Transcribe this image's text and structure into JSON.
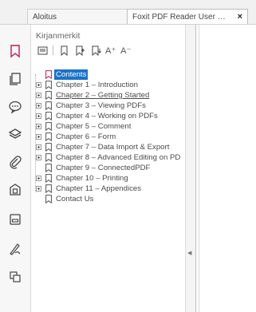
{
  "tabs": [
    {
      "label": "Aloitus"
    },
    {
      "label": "Foxit PDF Reader User M...",
      "close": "×"
    }
  ],
  "rail": {
    "items": [
      {
        "name": "bookmark-icon",
        "active": true
      },
      {
        "name": "pages-icon"
      },
      {
        "name": "comments-icon"
      },
      {
        "name": "layers-icon"
      },
      {
        "name": "attachment-icon"
      },
      {
        "name": "security-icon"
      },
      {
        "name": "form-fields-icon"
      },
      {
        "name": "signature-icon"
      },
      {
        "name": "page-thumbnails-icon"
      }
    ]
  },
  "panel": {
    "title": "Kirjanmerkit",
    "toolbar": {
      "font_larger": "A⁺",
      "font_smaller": "A⁻"
    },
    "bookmarks": [
      {
        "label": "Contents",
        "expandable": false,
        "selected": true,
        "color": "#c2185b"
      },
      {
        "label": "Chapter 1 – Introduction",
        "expandable": true
      },
      {
        "label": "Chapter 2 – Getting Started",
        "expandable": true,
        "underline": true
      },
      {
        "label": "Chapter 3 – Viewing PDFs",
        "expandable": true
      },
      {
        "label": "Chapter 4 – Working on PDFs",
        "expandable": true
      },
      {
        "label": "Chapter 5 – Comment",
        "expandable": true
      },
      {
        "label": "Chapter 6 – Form",
        "expandable": true
      },
      {
        "label": "Chapter 7 – Data Import & Export",
        "expandable": true
      },
      {
        "label": "Chapter 8 – Advanced Editing on PD",
        "expandable": true
      },
      {
        "label": "Chapter 9 – ConnectedPDF",
        "expandable": false
      },
      {
        "label": "Chapter 10 – Printing",
        "expandable": true
      },
      {
        "label": "Chapter 11 – Appendices",
        "expandable": true
      },
      {
        "label": "Contact Us",
        "expandable": false
      }
    ]
  },
  "splitter": {
    "arrow": "◀"
  },
  "colors": {
    "accent": "#c2185b",
    "selection": "#1a73c8"
  }
}
